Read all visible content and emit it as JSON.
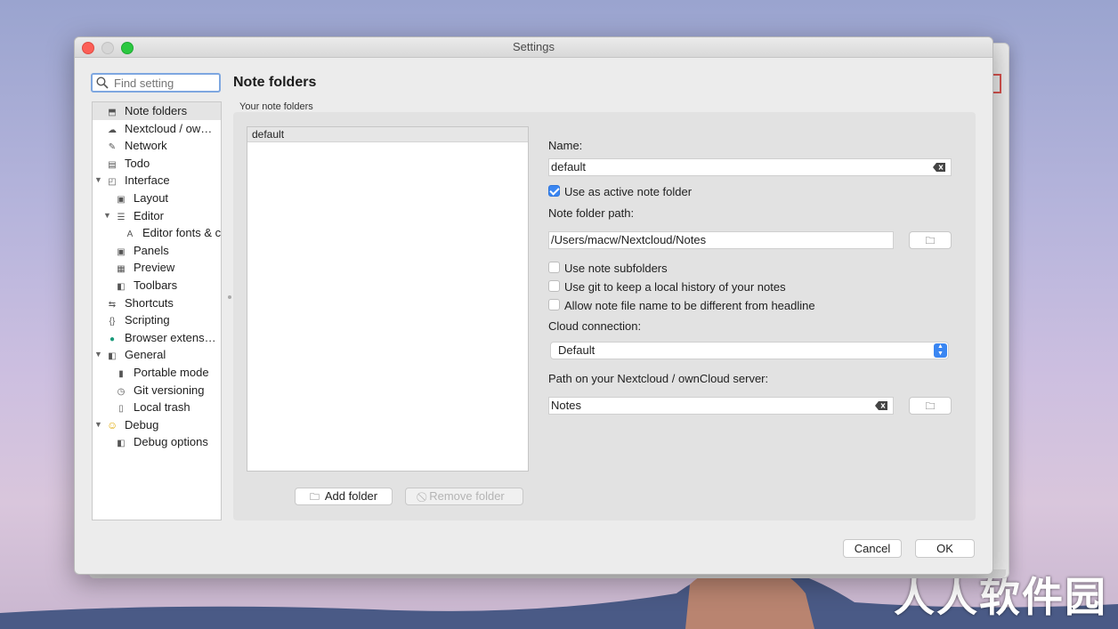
{
  "window": {
    "title": "Settings"
  },
  "search": {
    "placeholder": "Find setting"
  },
  "sidebar": {
    "items": [
      {
        "label": "Note folders",
        "icon": "folder-icon",
        "glyph": "⬒",
        "level": 0,
        "expand": "",
        "selected": true
      },
      {
        "label": "Nextcloud / ownCloud",
        "icon": "cloud-icon",
        "glyph": "☁",
        "level": 0,
        "expand": ""
      },
      {
        "label": "Network",
        "icon": "network-icon",
        "glyph": "✎",
        "level": 0,
        "expand": ""
      },
      {
        "label": "Todo",
        "icon": "todo-icon",
        "glyph": "▤",
        "level": 0,
        "expand": ""
      },
      {
        "label": "Interface",
        "icon": "interface-icon",
        "glyph": "◰",
        "level": 0,
        "expand": "▼"
      },
      {
        "label": "Layout",
        "icon": "layout-icon",
        "glyph": "▣",
        "level": 1,
        "expand": ""
      },
      {
        "label": "Editor",
        "icon": "editor-icon",
        "glyph": "☰",
        "level": 1,
        "expand": "▼"
      },
      {
        "label": "Editor fonts & colors",
        "icon": "font-icon",
        "glyph": "A",
        "level": 2,
        "expand": ""
      },
      {
        "label": "Panels",
        "icon": "panels-icon",
        "glyph": "▣",
        "level": 1,
        "expand": ""
      },
      {
        "label": "Preview",
        "icon": "preview-icon",
        "glyph": "▦",
        "level": 1,
        "expand": ""
      },
      {
        "label": "Toolbars",
        "icon": "toolbars-icon",
        "glyph": "◧",
        "level": 1,
        "expand": ""
      },
      {
        "label": "Shortcuts",
        "icon": "shortcuts-icon",
        "glyph": "⇆",
        "level": 0,
        "expand": ""
      },
      {
        "label": "Scripting",
        "icon": "scripting-icon",
        "glyph": "{}",
        "level": 0,
        "expand": ""
      },
      {
        "label": "Browser extension",
        "icon": "globe-icon",
        "glyph": "●",
        "level": 0,
        "expand": ""
      },
      {
        "label": "General",
        "icon": "general-icon",
        "glyph": "◧",
        "level": 0,
        "expand": "▼"
      },
      {
        "label": "Portable mode",
        "icon": "usb-icon",
        "glyph": "▮",
        "level": 1,
        "expand": ""
      },
      {
        "label": "Git versioning",
        "icon": "clock-icon",
        "glyph": "◷",
        "level": 1,
        "expand": ""
      },
      {
        "label": "Local trash",
        "icon": "trash-icon",
        "glyph": "▯",
        "level": 1,
        "expand": ""
      },
      {
        "label": "Debug",
        "icon": "smiley-icon",
        "glyph": "☺",
        "level": 0,
        "expand": "▼"
      },
      {
        "label": "Debug options",
        "icon": "debug-options-icon",
        "glyph": "◧",
        "level": 1,
        "expand": ""
      }
    ]
  },
  "main": {
    "title": "Note folders",
    "section_label": "Your note folders",
    "folders": [
      "default"
    ],
    "add_folder": "Add folder",
    "remove_folder": "Remove folder",
    "name_label": "Name:",
    "name_value": "default",
    "active_label": "Use as active note folder",
    "active_checked": true,
    "path_label": "Note folder path:",
    "path_value": "/Users/macw/Nextcloud/Notes",
    "subfolders_label": "Use note subfolders",
    "git_label": "Use git to keep a local history of your notes",
    "filename_label": "Allow note file name to be different from headline",
    "cloud_label": "Cloud connection:",
    "cloud_value": "Default",
    "server_path_label": "Path on your Nextcloud / ownCloud server:",
    "server_path_value": "Notes"
  },
  "footer": {
    "cancel": "Cancel",
    "ok": "OK"
  },
  "watermark": "人人软件园",
  "colors": {
    "accent": "#3a86f2",
    "close": "#fc5f57",
    "zoom": "#2bc840"
  }
}
